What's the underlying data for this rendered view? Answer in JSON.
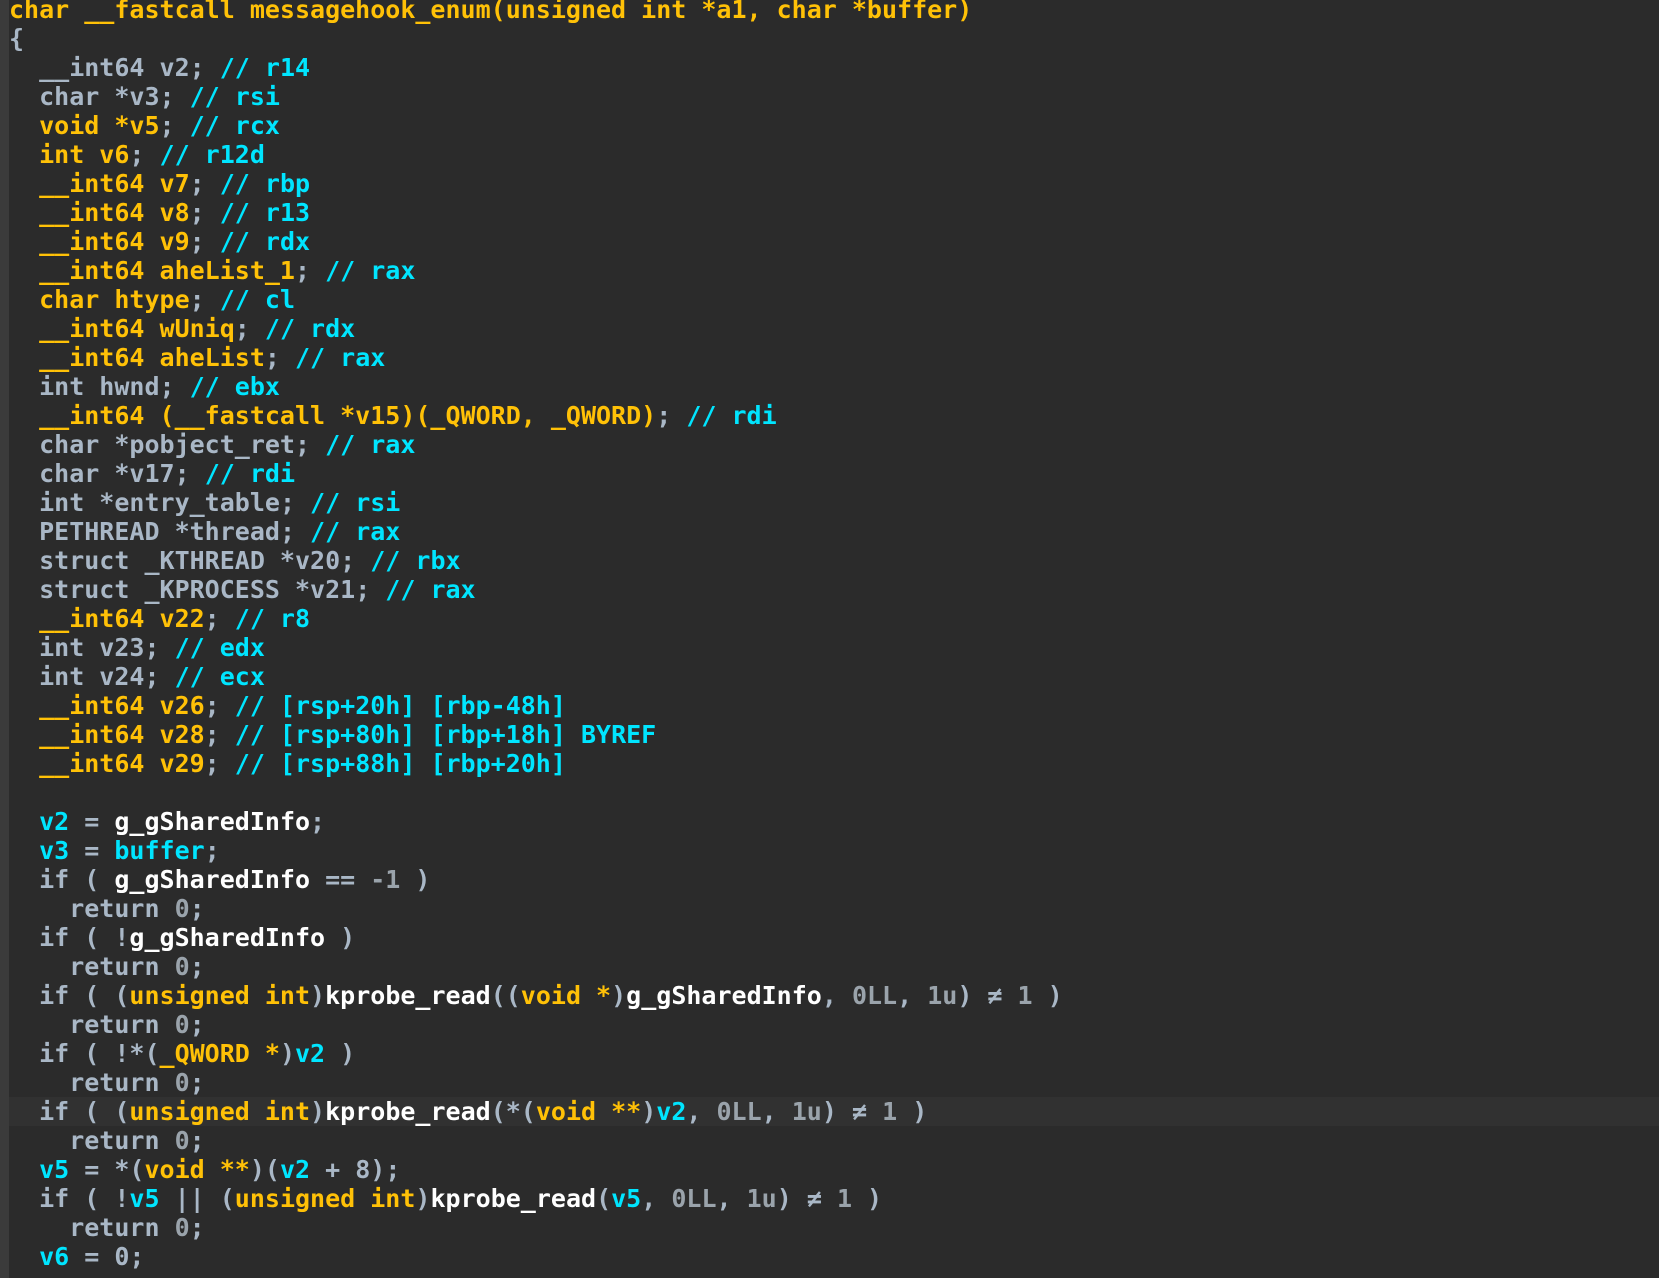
{
  "palette": {
    "background": "#2b2b2b",
    "keyword": "#ffc107",
    "variable": "#00e5ff",
    "comment": "#00e5ff",
    "identifier": "#ffffff",
    "muted": "#9aa3ab",
    "current_line": "#313131"
  },
  "code": {
    "lines": [
      {
        "tokens": [
          {
            "t": "char __fastcall messagehook_enum(unsigned int *a1, char *buffer)",
            "c": "k"
          }
        ]
      },
      {
        "tokens": [
          {
            "t": "{",
            "c": "d"
          }
        ]
      },
      {
        "tokens": [
          {
            "t": "  __int64 ",
            "c": "d"
          },
          {
            "t": "v2",
            "c": "d"
          },
          {
            "t": "; ",
            "c": "d"
          },
          {
            "t": "// r14",
            "c": "c"
          }
        ]
      },
      {
        "tokens": [
          {
            "t": "  char *v3",
            "c": "d"
          },
          {
            "t": "; ",
            "c": "d"
          },
          {
            "t": "// rsi",
            "c": "c"
          }
        ]
      },
      {
        "tokens": [
          {
            "t": "  void *v5",
            "c": "k"
          },
          {
            "t": "; ",
            "c": "d"
          },
          {
            "t": "// rcx",
            "c": "c"
          }
        ]
      },
      {
        "tokens": [
          {
            "t": "  int v6",
            "c": "k"
          },
          {
            "t": "; ",
            "c": "d"
          },
          {
            "t": "// r12d",
            "c": "c"
          }
        ]
      },
      {
        "tokens": [
          {
            "t": "  __int64 v7",
            "c": "k"
          },
          {
            "t": "; ",
            "c": "d"
          },
          {
            "t": "// rbp",
            "c": "c"
          }
        ]
      },
      {
        "tokens": [
          {
            "t": "  __int64 v8",
            "c": "k"
          },
          {
            "t": "; ",
            "c": "d"
          },
          {
            "t": "// r13",
            "c": "c"
          }
        ]
      },
      {
        "tokens": [
          {
            "t": "  __int64 v9",
            "c": "k"
          },
          {
            "t": "; ",
            "c": "d"
          },
          {
            "t": "// rdx",
            "c": "c"
          }
        ]
      },
      {
        "tokens": [
          {
            "t": "  __int64 aheList_1",
            "c": "k"
          },
          {
            "t": "; ",
            "c": "d"
          },
          {
            "t": "// rax",
            "c": "c"
          }
        ]
      },
      {
        "tokens": [
          {
            "t": "  char htype",
            "c": "k"
          },
          {
            "t": "; ",
            "c": "d"
          },
          {
            "t": "// cl",
            "c": "c"
          }
        ]
      },
      {
        "tokens": [
          {
            "t": "  __int64 wUniq",
            "c": "k"
          },
          {
            "t": "; ",
            "c": "d"
          },
          {
            "t": "// rdx",
            "c": "c"
          }
        ]
      },
      {
        "tokens": [
          {
            "t": "  __int64 aheList",
            "c": "k"
          },
          {
            "t": "; ",
            "c": "d"
          },
          {
            "t": "// rax",
            "c": "c"
          }
        ]
      },
      {
        "tokens": [
          {
            "t": "  int hwnd",
            "c": "d"
          },
          {
            "t": "; ",
            "c": "d"
          },
          {
            "t": "// ebx",
            "c": "c"
          }
        ]
      },
      {
        "tokens": [
          {
            "t": "  __int64 (__fastcall *v15)(_QWORD, _QWORD)",
            "c": "k"
          },
          {
            "t": "; ",
            "c": "d"
          },
          {
            "t": "// rdi",
            "c": "c"
          }
        ]
      },
      {
        "tokens": [
          {
            "t": "  char *pobject_ret",
            "c": "d"
          },
          {
            "t": "; ",
            "c": "d"
          },
          {
            "t": "// rax",
            "c": "c"
          }
        ]
      },
      {
        "tokens": [
          {
            "t": "  char *v17",
            "c": "d"
          },
          {
            "t": "; ",
            "c": "d"
          },
          {
            "t": "// rdi",
            "c": "c"
          }
        ]
      },
      {
        "tokens": [
          {
            "t": "  int *entry_table",
            "c": "d"
          },
          {
            "t": "; ",
            "c": "d"
          },
          {
            "t": "// rsi",
            "c": "c"
          }
        ]
      },
      {
        "tokens": [
          {
            "t": "  PETHREAD *thread",
            "c": "d"
          },
          {
            "t": "; ",
            "c": "d"
          },
          {
            "t": "// rax",
            "c": "c"
          }
        ]
      },
      {
        "tokens": [
          {
            "t": "  struct _KTHREAD *v20",
            "c": "d"
          },
          {
            "t": "; ",
            "c": "d"
          },
          {
            "t": "// rbx",
            "c": "c"
          }
        ]
      },
      {
        "tokens": [
          {
            "t": "  struct _KPROCESS *v21",
            "c": "d"
          },
          {
            "t": "; ",
            "c": "d"
          },
          {
            "t": "// rax",
            "c": "c"
          }
        ]
      },
      {
        "tokens": [
          {
            "t": "  __int64 v22",
            "c": "k"
          },
          {
            "t": "; ",
            "c": "d"
          },
          {
            "t": "// r8",
            "c": "c"
          }
        ]
      },
      {
        "tokens": [
          {
            "t": "  int v23",
            "c": "d"
          },
          {
            "t": "; ",
            "c": "d"
          },
          {
            "t": "// edx",
            "c": "c"
          }
        ]
      },
      {
        "tokens": [
          {
            "t": "  int v24",
            "c": "d"
          },
          {
            "t": "; ",
            "c": "d"
          },
          {
            "t": "// ecx",
            "c": "c"
          }
        ]
      },
      {
        "tokens": [
          {
            "t": "  __int64 v26",
            "c": "k"
          },
          {
            "t": "; ",
            "c": "d"
          },
          {
            "t": "// [rsp+20h] [rbp-48h]",
            "c": "c"
          }
        ]
      },
      {
        "tokens": [
          {
            "t": "  __int64 v28",
            "c": "k"
          },
          {
            "t": "; ",
            "c": "d"
          },
          {
            "t": "// [rsp+80h] [rbp+18h] BYREF",
            "c": "c"
          }
        ]
      },
      {
        "tokens": [
          {
            "t": "  __int64 v29",
            "c": "k"
          },
          {
            "t": "; ",
            "c": "d"
          },
          {
            "t": "// [rsp+88h] [rbp+20h]",
            "c": "c"
          }
        ]
      },
      {
        "tokens": [
          {
            "t": "",
            "c": "d"
          }
        ]
      },
      {
        "tokens": [
          {
            "t": "  v2",
            "c": "v"
          },
          {
            "t": " = ",
            "c": "d"
          },
          {
            "t": "g_gSharedInfo",
            "c": "f"
          },
          {
            "t": ";",
            "c": "d"
          }
        ]
      },
      {
        "tokens": [
          {
            "t": "  v3",
            "c": "v"
          },
          {
            "t": " = ",
            "c": "d"
          },
          {
            "t": "buffer",
            "c": "v"
          },
          {
            "t": ";",
            "c": "d"
          }
        ]
      },
      {
        "tokens": [
          {
            "t": "  if ( ",
            "c": "d"
          },
          {
            "t": "g_gSharedInfo",
            "c": "f"
          },
          {
            "t": " == ",
            "c": "d"
          },
          {
            "t": "-1",
            "c": "n"
          },
          {
            "t": " )",
            "c": "d"
          }
        ]
      },
      {
        "tokens": [
          {
            "t": "    return ",
            "c": "d"
          },
          {
            "t": "0",
            "c": "n"
          },
          {
            "t": ";",
            "c": "d"
          }
        ]
      },
      {
        "tokens": [
          {
            "t": "  if ( !",
            "c": "d"
          },
          {
            "t": "g_gSharedInfo",
            "c": "f"
          },
          {
            "t": " )",
            "c": "d"
          }
        ]
      },
      {
        "tokens": [
          {
            "t": "    return ",
            "c": "d"
          },
          {
            "t": "0",
            "c": "n"
          },
          {
            "t": ";",
            "c": "d"
          }
        ]
      },
      {
        "tokens": [
          {
            "t": "  if ( (",
            "c": "d"
          },
          {
            "t": "unsigned int",
            "c": "k"
          },
          {
            "t": ")",
            "c": "d"
          },
          {
            "t": "kprobe_read",
            "c": "f"
          },
          {
            "t": "((",
            "c": "d"
          },
          {
            "t": "void *",
            "c": "k"
          },
          {
            "t": ")",
            "c": "d"
          },
          {
            "t": "g_gSharedInfo",
            "c": "f"
          },
          {
            "t": ", ",
            "c": "d"
          },
          {
            "t": "0LL",
            "c": "n"
          },
          {
            "t": ", ",
            "c": "d"
          },
          {
            "t": "1u",
            "c": "n"
          },
          {
            "t": ") ≠ ",
            "c": "d"
          },
          {
            "t": "1",
            "c": "n"
          },
          {
            "t": " )",
            "c": "d"
          }
        ]
      },
      {
        "tokens": [
          {
            "t": "    return ",
            "c": "d"
          },
          {
            "t": "0",
            "c": "n"
          },
          {
            "t": ";",
            "c": "d"
          }
        ]
      },
      {
        "tokens": [
          {
            "t": "  if ( !*(",
            "c": "d"
          },
          {
            "t": "_QWORD *",
            "c": "k"
          },
          {
            "t": ")",
            "c": "d"
          },
          {
            "t": "v2",
            "c": "v"
          },
          {
            "t": " )",
            "c": "d"
          }
        ]
      },
      {
        "tokens": [
          {
            "t": "    return ",
            "c": "d"
          },
          {
            "t": "0",
            "c": "n"
          },
          {
            "t": ";",
            "c": "d"
          }
        ]
      },
      {
        "tokens": [
          {
            "t": "  if ( (",
            "c": "d"
          },
          {
            "t": "unsigned int",
            "c": "k"
          },
          {
            "t": ")",
            "c": "d"
          },
          {
            "t": "kprobe_read",
            "c": "f"
          },
          {
            "t": "(*(",
            "c": "d"
          },
          {
            "t": "void **",
            "c": "k"
          },
          {
            "t": ")",
            "c": "d"
          },
          {
            "t": "v2",
            "c": "v"
          },
          {
            "t": ", ",
            "c": "d"
          },
          {
            "t": "0LL",
            "c": "n"
          },
          {
            "t": ", ",
            "c": "d"
          },
          {
            "t": "1u",
            "c": "n"
          },
          {
            "t": ") ≠ ",
            "c": "d"
          },
          {
            "t": "1",
            "c": "n"
          },
          {
            "t": " )",
            "c": "d"
          }
        ],
        "highlight": true
      },
      {
        "tokens": [
          {
            "t": "    return ",
            "c": "d"
          },
          {
            "t": "0",
            "c": "n"
          },
          {
            "t": ";",
            "c": "d"
          }
        ]
      },
      {
        "tokens": [
          {
            "t": "  v5",
            "c": "v"
          },
          {
            "t": " = *(",
            "c": "d"
          },
          {
            "t": "void **",
            "c": "k"
          },
          {
            "t": ")(",
            "c": "d"
          },
          {
            "t": "v2",
            "c": "v"
          },
          {
            "t": " + 8);",
            "c": "d"
          }
        ]
      },
      {
        "tokens": [
          {
            "t": "  if ( !",
            "c": "d"
          },
          {
            "t": "v5",
            "c": "v"
          },
          {
            "t": " || (",
            "c": "d"
          },
          {
            "t": "unsigned int",
            "c": "k"
          },
          {
            "t": ")",
            "c": "d"
          },
          {
            "t": "kprobe_read",
            "c": "f"
          },
          {
            "t": "(",
            "c": "d"
          },
          {
            "t": "v5",
            "c": "v"
          },
          {
            "t": ", ",
            "c": "d"
          },
          {
            "t": "0LL",
            "c": "n"
          },
          {
            "t": ", ",
            "c": "d"
          },
          {
            "t": "1u",
            "c": "n"
          },
          {
            "t": ") ≠ ",
            "c": "d"
          },
          {
            "t": "1",
            "c": "n"
          },
          {
            "t": " )",
            "c": "d"
          }
        ]
      },
      {
        "tokens": [
          {
            "t": "    return ",
            "c": "d"
          },
          {
            "t": "0",
            "c": "n"
          },
          {
            "t": ";",
            "c": "d"
          }
        ]
      },
      {
        "tokens": [
          {
            "t": "  v6",
            "c": "v"
          },
          {
            "t": " = 0;",
            "c": "d"
          }
        ]
      }
    ]
  }
}
